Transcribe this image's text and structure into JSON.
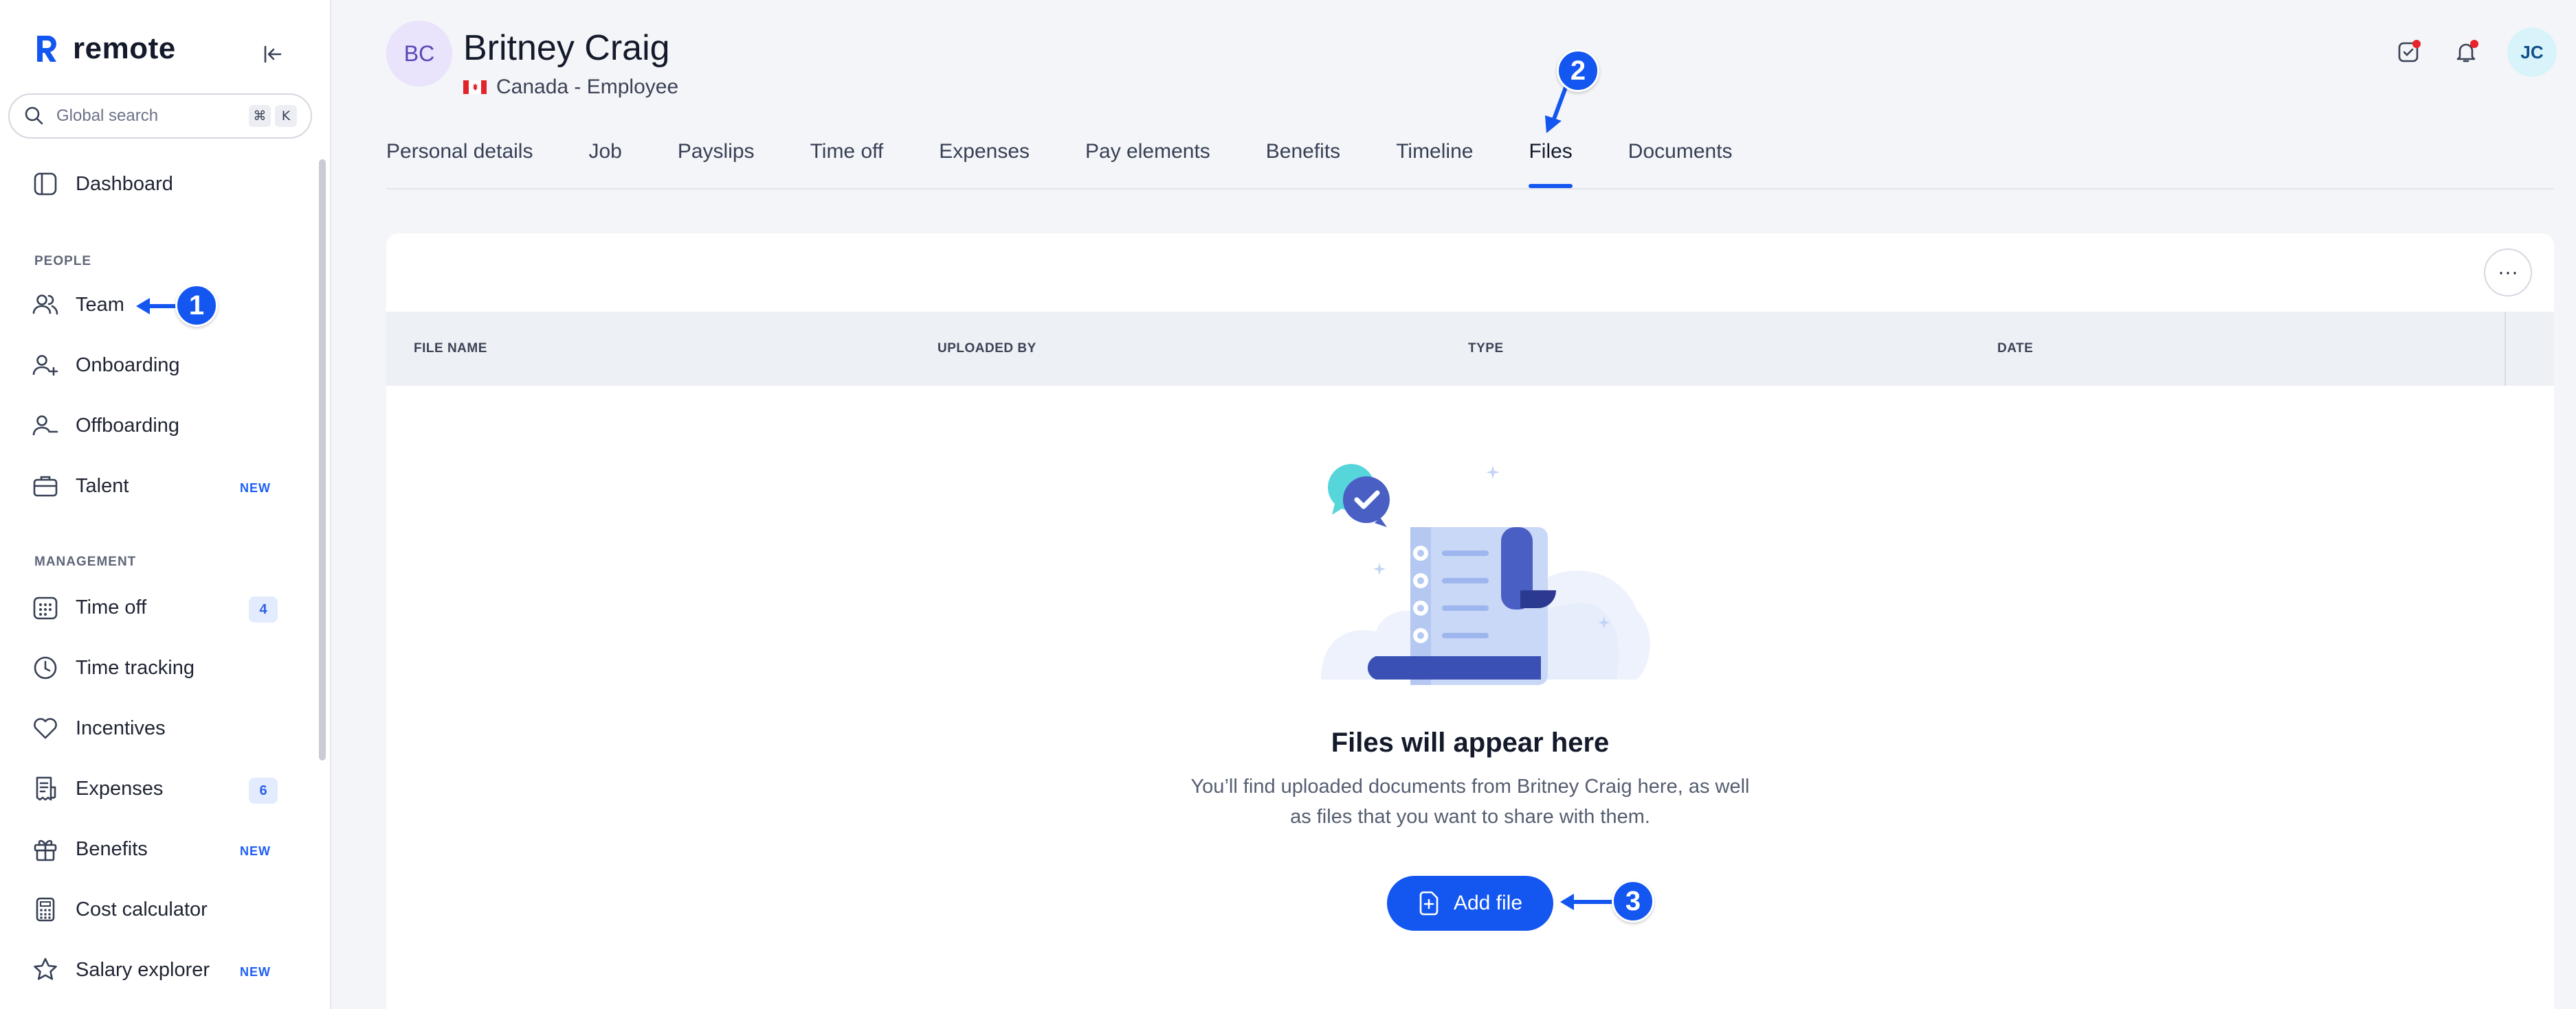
{
  "app": {
    "brand_name": "remote",
    "accent": "#1356f0"
  },
  "sidebar": {
    "search": {
      "placeholder": "Global search",
      "shortcut_1": "⌘",
      "shortcut_2": "K"
    },
    "dashboard_label": "Dashboard",
    "section_people": "PEOPLE",
    "section_management": "MANAGEMENT",
    "items": [
      {
        "label": "Team",
        "icon": "people-icon"
      },
      {
        "label": "Onboarding",
        "icon": "user-plus-icon"
      },
      {
        "label": "Offboarding",
        "icon": "user-minus-icon"
      },
      {
        "label": "Talent",
        "icon": "briefcase-icon",
        "badge": "NEW"
      },
      {
        "label": "Time off",
        "icon": "calendar-icon",
        "badge": "4"
      },
      {
        "label": "Time tracking",
        "icon": "clock-icon"
      },
      {
        "label": "Incentives",
        "icon": "heart-icon"
      },
      {
        "label": "Expenses",
        "icon": "receipt-icon",
        "badge": "6"
      },
      {
        "label": "Benefits",
        "icon": "gift-icon",
        "badge": "NEW"
      },
      {
        "label": "Cost calculator",
        "icon": "calculator-icon"
      },
      {
        "label": "Salary explorer",
        "icon": "star-icon",
        "badge": "NEW"
      }
    ]
  },
  "header": {
    "avatar_initials": "BC",
    "employee_name": "Britney Craig",
    "employee_sub": "Canada - Employee",
    "user_initials": "JC"
  },
  "tabs": [
    {
      "label": "Personal details"
    },
    {
      "label": "Job"
    },
    {
      "label": "Payslips"
    },
    {
      "label": "Time off"
    },
    {
      "label": "Expenses"
    },
    {
      "label": "Pay elements"
    },
    {
      "label": "Benefits"
    },
    {
      "label": "Timeline"
    },
    {
      "label": "Files",
      "active": true
    },
    {
      "label": "Documents"
    }
  ],
  "table": {
    "columns": [
      "FILE NAME",
      "UPLOADED BY",
      "TYPE",
      "DATE"
    ],
    "more_label": "···"
  },
  "empty_state": {
    "title": "Files will appear here",
    "description": "You’ll find uploaded documents from Britney Craig here, as well as files that you want to share with them.",
    "button_label": "Add file"
  },
  "annotations": [
    "1",
    "2",
    "3"
  ]
}
